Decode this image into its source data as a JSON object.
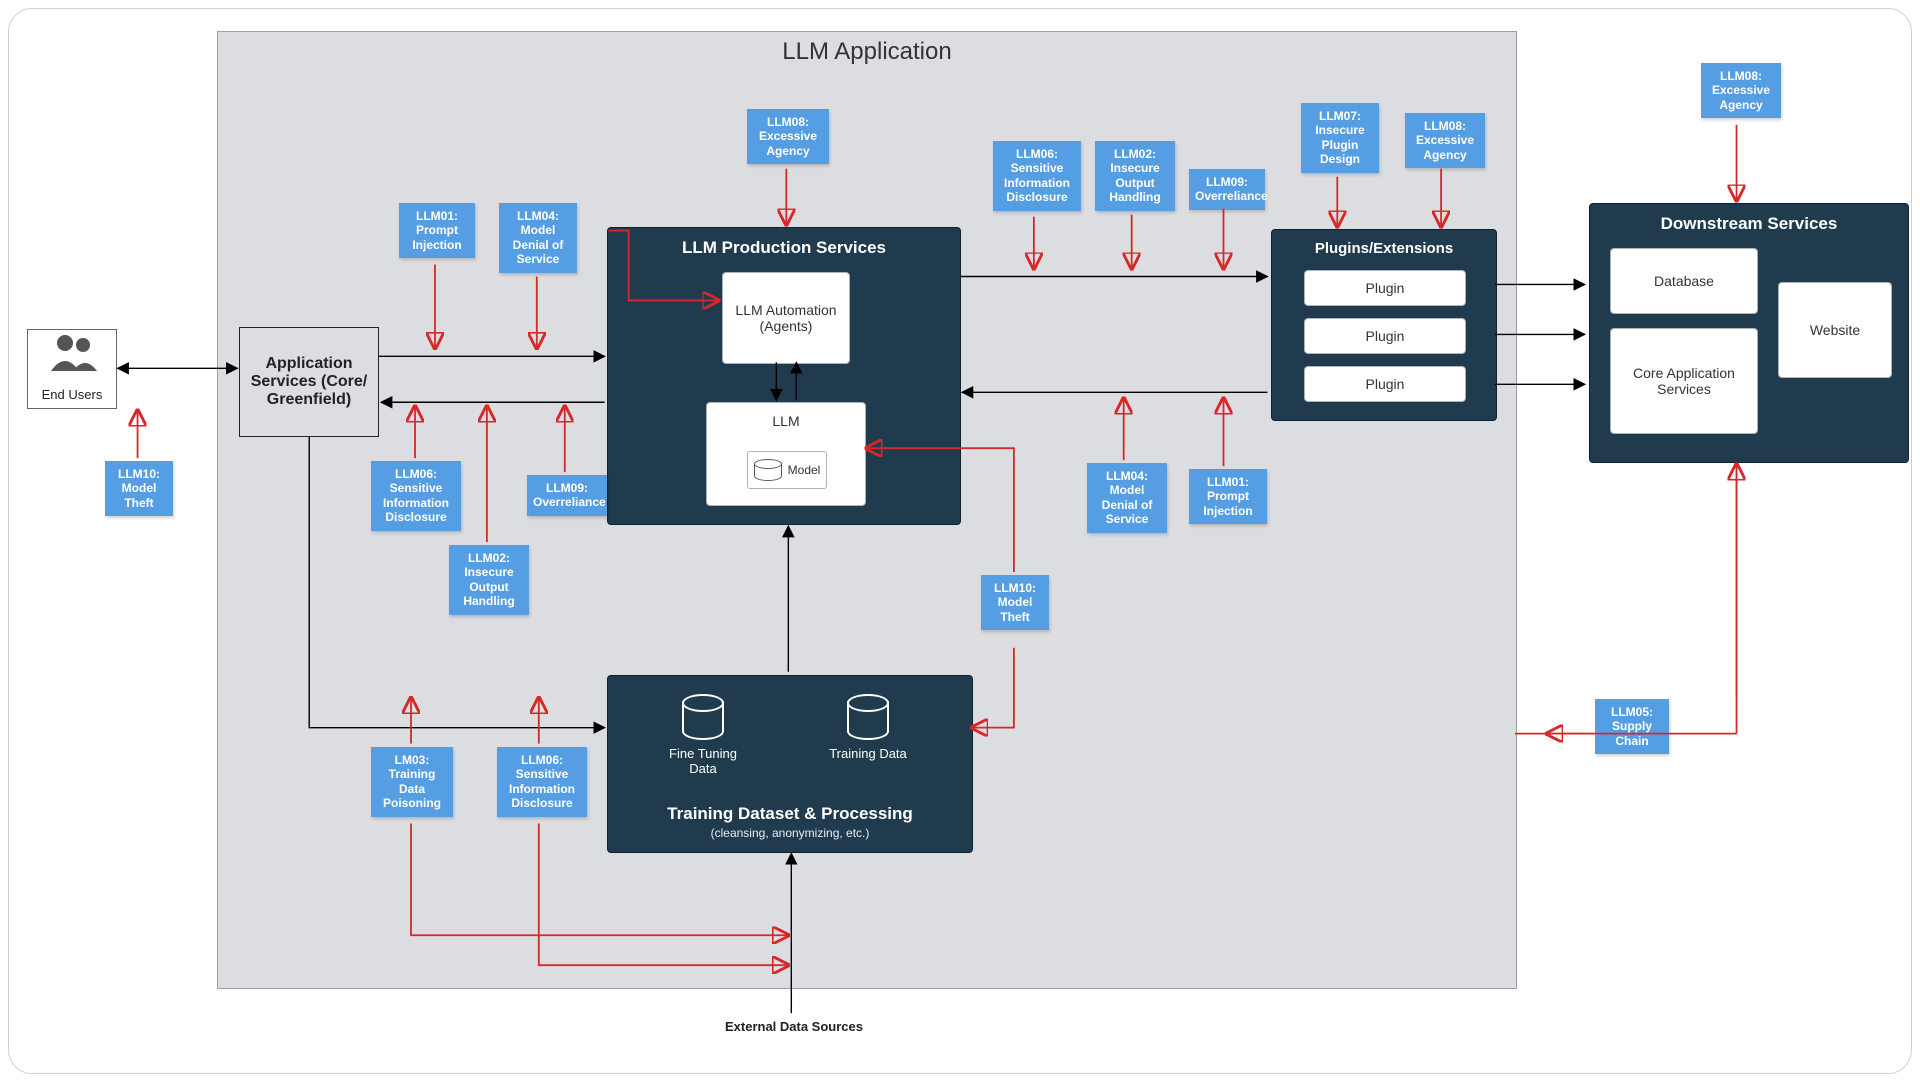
{
  "region": {
    "title": "LLM Application"
  },
  "appServices": {
    "title": "Application Services (Core/ Greenfield)"
  },
  "endUsers": {
    "label": "End Users"
  },
  "externalData": {
    "label": "External Data Sources"
  },
  "prodServices": {
    "title": "LLM Production Services",
    "agents": "LLM Automation (Agents)",
    "llmBox": "LLM",
    "model": "Model"
  },
  "training": {
    "title": "Training Dataset & Processing",
    "subtitle": "(cleansing, anonymizing, etc.)",
    "fineTuning": "Fine Tuning Data",
    "trainingData": "Training Data"
  },
  "plugins": {
    "title": "Plugins/Extensions",
    "items": [
      "Plugin",
      "Plugin",
      "Plugin"
    ]
  },
  "downstream": {
    "title": "Downstream Services",
    "database": "Database",
    "website": "Website",
    "coreApp": "Core Application Services"
  },
  "notes": {
    "llm01_top": {
      "id": "LLM01:",
      "name": "Prompt Injection"
    },
    "llm04_top": {
      "id": "LLM04:",
      "name": "Model Denial of Service"
    },
    "llm08_top": {
      "id": "LLM08:",
      "name": "Excessive Agency"
    },
    "llm06_topR": {
      "id": "LLM06:",
      "name": "Sensitive Information Disclosure"
    },
    "llm02_topR": {
      "id": "LLM02:",
      "name": "Insecure Output Handling"
    },
    "llm09_topR": {
      "id": "LLM09:",
      "name": "Overreliance"
    },
    "llm07_plug": {
      "id": "LLM07:",
      "name": "Insecure Plugin Design"
    },
    "llm08_plug": {
      "id": "LLM08:",
      "name": "Excessive Agency"
    },
    "llm08_ds": {
      "id": "LLM08:",
      "name": "Excessive Agency"
    },
    "llm10_left": {
      "id": "LLM10:",
      "name": "Model Theft"
    },
    "llm06_mid": {
      "id": "LLM06:",
      "name": "Sensitive Information Disclosure"
    },
    "llm02_mid": {
      "id": "LLM02:",
      "name": "Insecure Output Handling"
    },
    "llm09_mid": {
      "id": "LLM09:",
      "name": "Overreliance"
    },
    "llm04_low": {
      "id": "LLM04:",
      "name": "Model Denial of Service"
    },
    "llm01_low": {
      "id": "LLM01:",
      "name": "Prompt Injection"
    },
    "llm10_low": {
      "id": "LLM10:",
      "name": "Model Theft"
    },
    "lm03_train": {
      "id": "LM03:",
      "name": "Training Data Poisoning"
    },
    "llm06_train": {
      "id": "LLM06:",
      "name": "Sensitive Information Disclosure"
    },
    "llm05_ds": {
      "id": "LLM05:",
      "name": "Supply Chain"
    }
  },
  "colors": {
    "note": "#569ee3",
    "dark": "#1f3b4d",
    "region": "#dcdde0",
    "red": "#d62828",
    "black": "#000000"
  }
}
